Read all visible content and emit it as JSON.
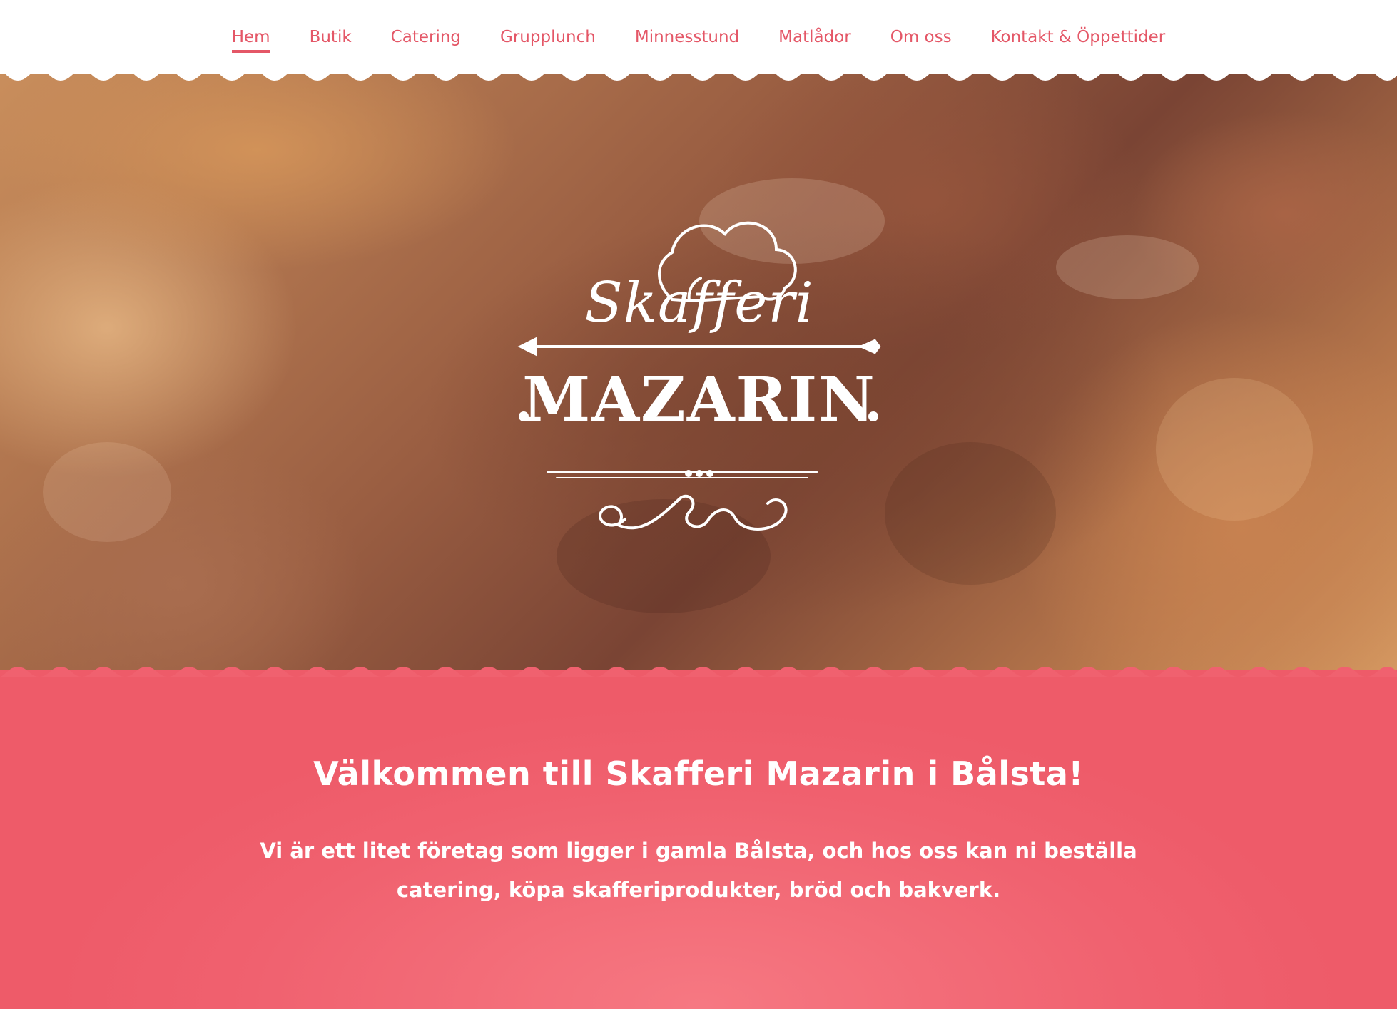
{
  "nav": {
    "items": [
      {
        "label": "Hem",
        "active": true
      },
      {
        "label": "Butik",
        "active": false
      },
      {
        "label": "Catering",
        "active": false
      },
      {
        "label": "Grupplunch",
        "active": false
      },
      {
        "label": "Minnesstund",
        "active": false
      },
      {
        "label": "Matlådor",
        "active": false
      },
      {
        "label": "Om oss",
        "active": false
      },
      {
        "label": "Kontakt & Öppettider",
        "active": false
      }
    ]
  },
  "hero": {
    "image": "bread-loaves-photo",
    "logo": {
      "script_text": "Skafferi",
      "main_text": "MAZARIN",
      "icon": "chef-hat-icon"
    }
  },
  "welcome": {
    "heading": "Välkommen till Skafferi Mazarin i Bålsta!",
    "body": "Vi är ett litet företag som ligger i gamla Bålsta, och hos oss kan ni beställa catering, köpa skafferiprodukter, bröd och bakverk."
  },
  "colors": {
    "accent": "#e45767",
    "section_bg": "#f0616f",
    "white": "#ffffff"
  }
}
